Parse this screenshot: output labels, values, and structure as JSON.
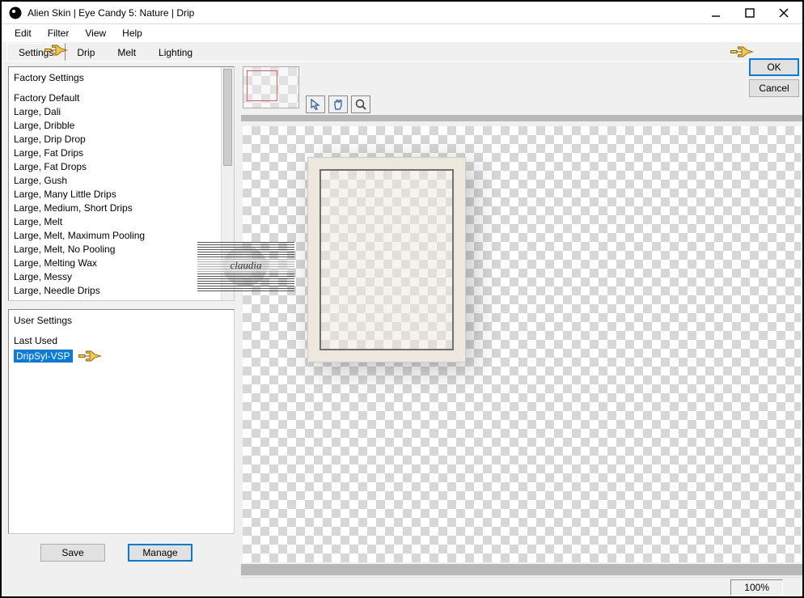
{
  "window": {
    "title": "Alien Skin | Eye Candy 5: Nature | Drip"
  },
  "menubar": [
    "Edit",
    "Filter",
    "View",
    "Help"
  ],
  "tabs": [
    {
      "label": "Settings",
      "active": true
    },
    {
      "label": "Drip",
      "active": false
    },
    {
      "label": "Melt",
      "active": false
    },
    {
      "label": "Lighting",
      "active": false
    }
  ],
  "factory": {
    "header": "Factory Settings",
    "items": [
      "Factory Default",
      "Large, Dali",
      "Large, Dribble",
      "Large, Drip Drop",
      "Large, Fat Drips",
      "Large, Fat Drops",
      "Large, Gush",
      "Large, Many Little Drips",
      "Large, Medium, Short Drips",
      "Large, Melt",
      "Large, Melt, Maximum Pooling",
      "Large, Melt, No Pooling",
      "Large, Melting Wax",
      "Large, Messy",
      "Large, Needle Drips"
    ]
  },
  "user": {
    "header": "User Settings",
    "last_used": "Last Used",
    "selected": "DripSyl-VSP"
  },
  "buttons": {
    "save": "Save",
    "manage": "Manage",
    "ok": "OK",
    "cancel": "Cancel"
  },
  "status": {
    "zoom": "100%"
  },
  "watermark": "claudia"
}
